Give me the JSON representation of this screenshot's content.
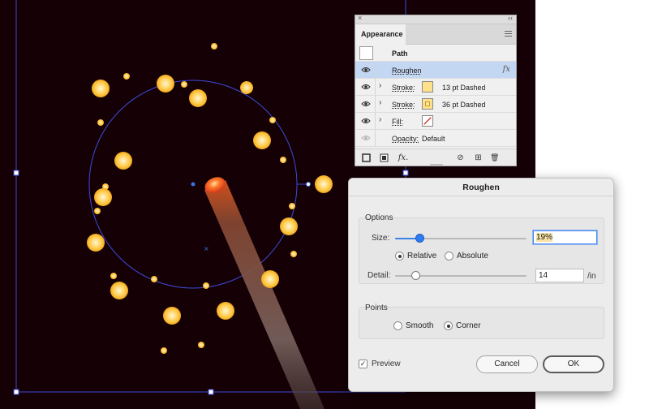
{
  "appearance_panel": {
    "close_glyph": "×",
    "collapse_glyph": "‹‹",
    "tab_label": "Appearance",
    "menu_icon": "hamburger-icon",
    "path_title": "Path",
    "rows": [
      {
        "label": "Roughen",
        "icon": "fx-icon",
        "fx": "fx"
      },
      {
        "label": "Stroke:",
        "value": "13 pt Dashed",
        "chevron": "›"
      },
      {
        "label": "Stroke:",
        "value": "36 pt Dashed",
        "chevron": "›"
      },
      {
        "label": "Fill:",
        "chevron": "›"
      },
      {
        "label": "Opacity:",
        "value": "Default"
      }
    ],
    "footer_icons": [
      "add-stroke-icon",
      "add-fill-icon",
      "fx-menu-icon",
      "clear-appearance-icon",
      "duplicate-item-icon",
      "delete-item-icon"
    ],
    "footer_fx": "fx.",
    "footer_no": "⊘",
    "footer_dup": "⊞",
    "footer_trash": "🗑"
  },
  "roughen_dialog": {
    "title": "Roughen",
    "options_label": "Options",
    "size_label": "Size:",
    "size_value": "19%",
    "size_fraction": 0.19,
    "relative_label": "Relative",
    "absolute_label": "Absolute",
    "size_mode": "Relative",
    "detail_label": "Detail:",
    "detail_value": "14",
    "detail_unit": "/in",
    "points_label": "Points",
    "smooth_label": "Smooth",
    "corner_label": "Corner",
    "points_mode": "Corner",
    "preview_label": "Preview",
    "preview_checked": true,
    "cancel_label": "Cancel",
    "ok_label": "OK",
    "accent_color": "#2f7cf0"
  },
  "canvas": {
    "background_color": "#150006",
    "selection_color": "#3b4bd6",
    "dot_color": "#ffc53d",
    "dot_highlight": "#fff3c9"
  }
}
